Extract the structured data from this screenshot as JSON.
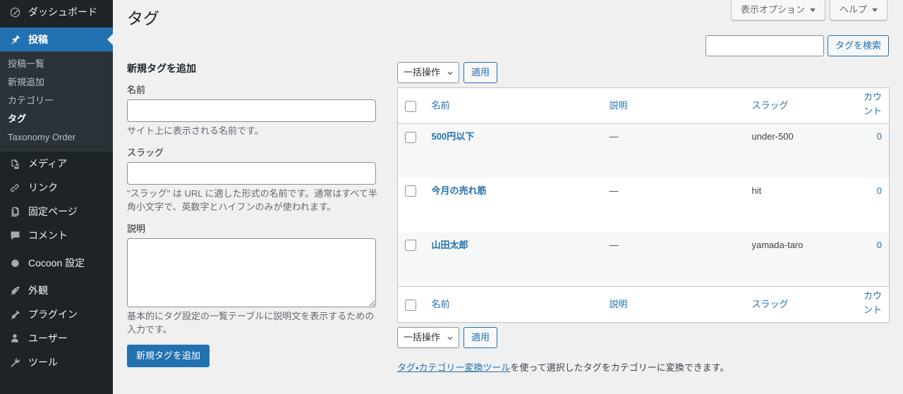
{
  "sidebar": {
    "items": [
      {
        "label": "ダッシュボード",
        "icon": "dashboard-icon",
        "current": false
      },
      {
        "label": "投稿",
        "icon": "pin-icon",
        "current": true
      },
      {
        "label": "メディア",
        "icon": "media-icon",
        "current": false
      },
      {
        "label": "リンク",
        "icon": "link-icon",
        "current": false
      },
      {
        "label": "固定ページ",
        "icon": "pages-icon",
        "current": false
      },
      {
        "label": "コメント",
        "icon": "comment-icon",
        "current": false
      },
      {
        "label": "Cocoon 設定",
        "icon": "circle-icon",
        "current": false
      },
      {
        "label": "外観",
        "icon": "appearance-icon",
        "current": false
      },
      {
        "label": "プラグイン",
        "icon": "plugin-icon",
        "current": false
      },
      {
        "label": "ユーザー",
        "icon": "user-icon",
        "current": false
      },
      {
        "label": "ツール",
        "icon": "tools-icon",
        "current": false
      }
    ],
    "submenu": [
      {
        "label": "投稿一覧",
        "current": false
      },
      {
        "label": "新規追加",
        "current": false
      },
      {
        "label": "カテゴリー",
        "current": false
      },
      {
        "label": "タグ",
        "current": true
      },
      {
        "label": "Taxonomy Order",
        "current": false
      }
    ]
  },
  "screen_meta": {
    "screen_options_label": "表示オプション",
    "help_label": "ヘルプ"
  },
  "header": {
    "page_title": "タグ"
  },
  "search": {
    "value": "",
    "placeholder": "",
    "button_label": "タグを検索"
  },
  "form": {
    "heading": "新規タグを追加",
    "name_label": "名前",
    "name_value": "",
    "name_description": "サイト上に表示される名前です。",
    "slug_label": "スラッグ",
    "slug_value": "",
    "slug_description": "\"スラッグ\" は URL に適した形式の名前です。通常はすべて半角小文字で、英数字とハイフンのみが使われます。",
    "description_label": "説明",
    "description_value": "",
    "description_description": "基本的にタグ設定の一覧テーブルに説明文を表示するための入力です。",
    "submit_label": "新規タグを追加"
  },
  "tablenav": {
    "bulk_action_label": "一括操作",
    "apply_label": "適用"
  },
  "table": {
    "columns": {
      "name": "名前",
      "description": "説明",
      "slug": "スラッグ",
      "count": "カウント"
    },
    "rows": [
      {
        "name": "500円以下",
        "description": "—",
        "slug": "under-500",
        "count": "0"
      },
      {
        "name": "今月の売れ筋",
        "description": "—",
        "slug": "hit",
        "count": "0"
      },
      {
        "name": "山田太郎",
        "description": "—",
        "slug": "yamada-taro",
        "count": "0"
      }
    ]
  },
  "footer_note": {
    "link_text": "タグ・カテゴリー変換ツール",
    "rest_text": "を使って選択したタグをカテゴリーに変換できます。"
  },
  "colors": {
    "sidebar_bg": "#1d2327",
    "submenu_bg": "#2c3338",
    "accent": "#2271b1",
    "page_bg": "#f0f0f1",
    "row_alt": "#f6f7f7"
  }
}
